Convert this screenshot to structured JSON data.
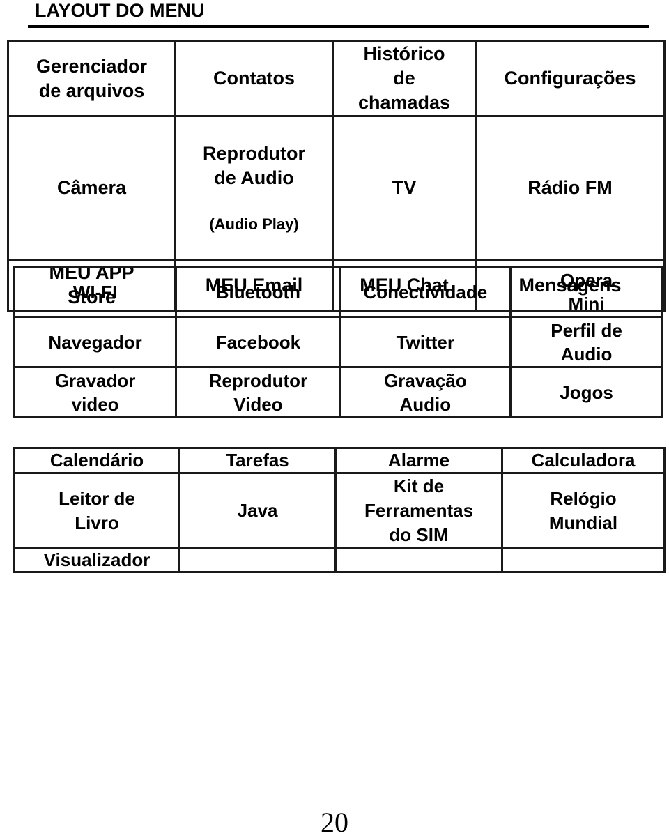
{
  "section_title": "LAYOUT DO MENU",
  "tables": [
    {
      "rows": [
        [
          "Gerenciador\nde arquivos",
          "Contatos",
          "Histórico\nde\nchamadas",
          "Configurações"
        ],
        [
          "Câmera",
          "Reprodutor\nde Audio",
          "TV",
          "Rádio FM"
        ],
        [
          "MEU APP\nStore",
          "MEU Email",
          "MEU Chat",
          "Mensagens"
        ]
      ],
      "notes": {
        "audio_player_subtitle": "(Audio Play)"
      }
    },
    {
      "rows": [
        [
          "WI-FI",
          "Bluetooth",
          "Conectividade",
          "Opera\nMini"
        ],
        [
          "Navegador",
          "Facebook",
          "Twitter",
          "Perfil de\nAudio"
        ],
        [
          "Gravador\nvideo",
          "Reprodutor\nVideo",
          "Gravação\nAudio",
          "Jogos"
        ]
      ]
    },
    {
      "rows": [
        [
          "Calendário",
          "Tarefas",
          "Alarme",
          "Calculadora"
        ],
        [
          "Leitor de\nLivro",
          "Java",
          "Kit de\nFerramentas\ndo SIM",
          "Relógio\nMundial"
        ],
        [
          "Visualizador",
          "",
          "",
          ""
        ]
      ]
    }
  ],
  "page_number": "20"
}
